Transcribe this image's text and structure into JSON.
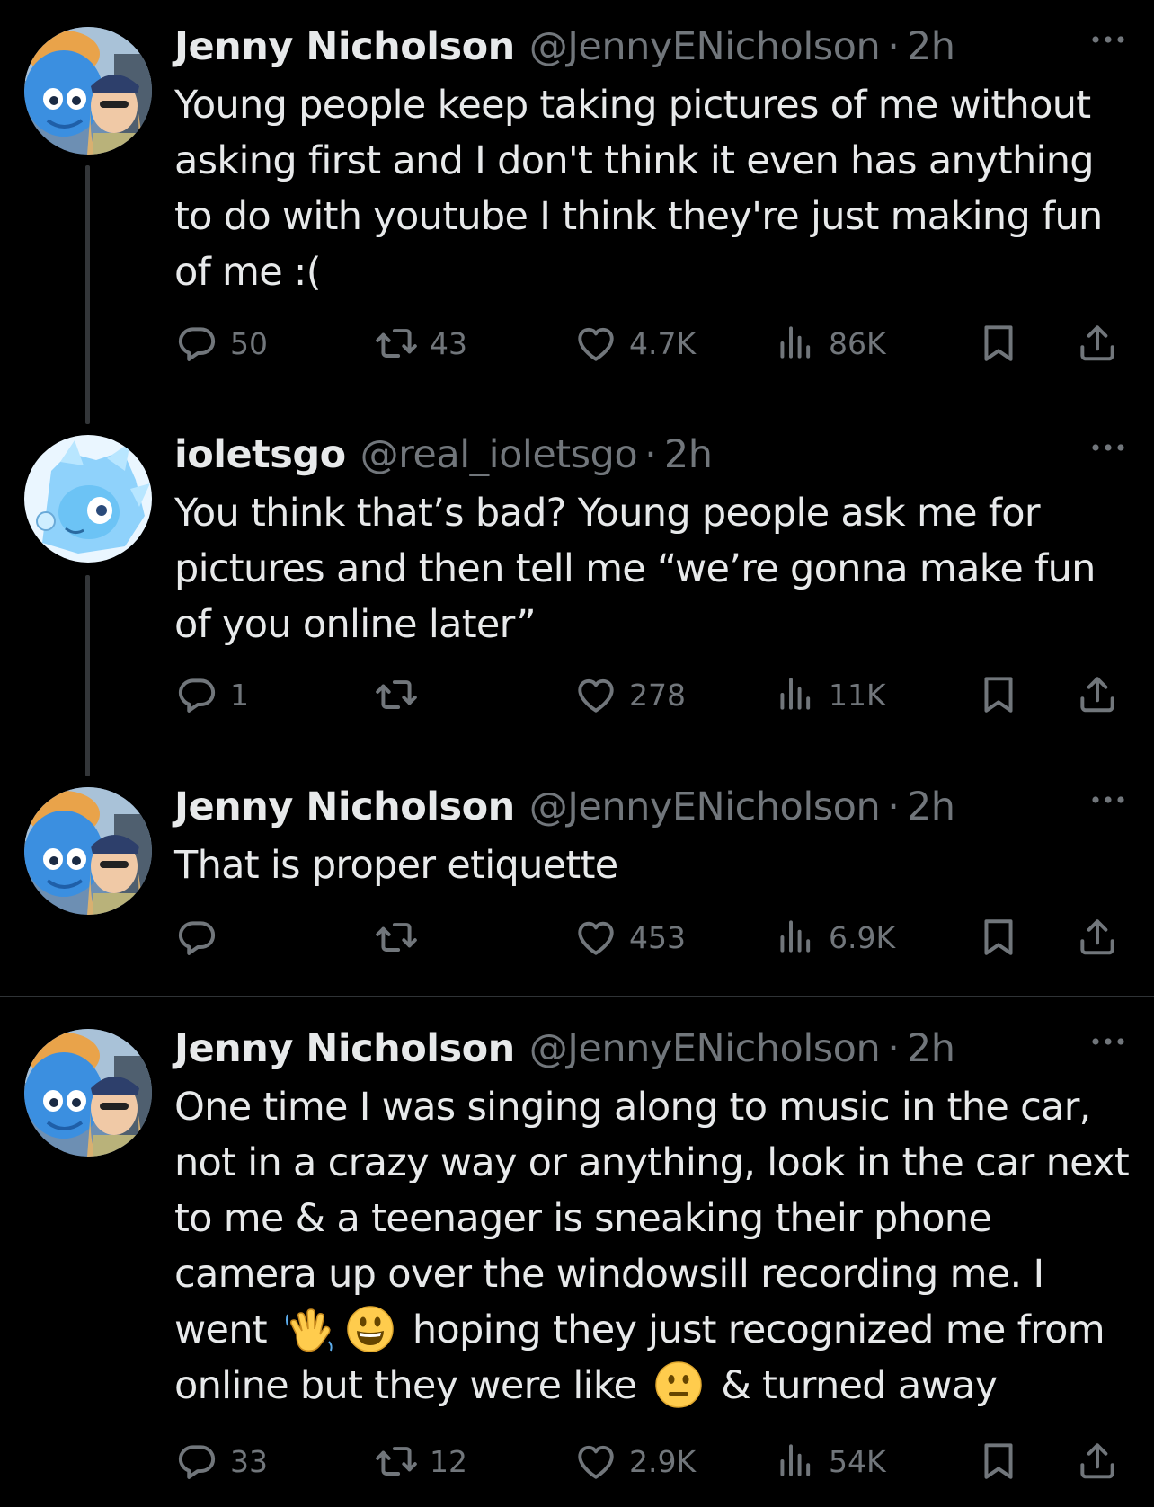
{
  "colors": {
    "background": "#000000",
    "text_primary": "#e7e9ea",
    "text_secondary": "#71767b",
    "thread_line": "#333639",
    "separator": "#2f3336"
  },
  "icons": {
    "reply": "reply-icon",
    "retweet": "retweet-icon",
    "like": "heart-icon",
    "views": "views-chart-icon",
    "bookmark": "bookmark-icon",
    "share": "share-icon",
    "more": "more-dots-icon"
  },
  "tweets": [
    {
      "name": "Jenny Nicholson",
      "handle": "@JennyENicholson",
      "time": "2h",
      "text": "Young people keep taking pictures of me without\nasking first and I don't think it even has anything\nto do with youtube I think they're just making fun\nof me :(",
      "replies": "50",
      "retweets": "43",
      "likes": "4.7K",
      "views": "86K"
    },
    {
      "name": "ioletsgo",
      "handle": "@real_ioletsgo",
      "time": "2h",
      "text": "You think that’s bad? Young people ask me for\npictures and then tell me “we’re gonna make fun\nof you online later”",
      "replies": "1",
      "retweets": "",
      "likes": "278",
      "views": "11K"
    },
    {
      "name": "Jenny Nicholson",
      "handle": "@JennyENicholson",
      "time": "2h",
      "text": "That is proper etiquette",
      "replies": "",
      "retweets": "",
      "likes": "453",
      "views": "6.9K"
    },
    {
      "name": "Jenny Nicholson",
      "handle": "@JennyENicholson",
      "time": "2h",
      "text_lines": [
        "One time I was singing along to music in the car,",
        "not in a crazy way or anything, look in the car next",
        "to me & a teenager is sneaking their phone",
        "camera up over the windowsill recording me. I"
      ],
      "text_went": "went",
      "text_hoping": "hoping they just recognized me from",
      "text_online": "online but they were like",
      "text_turned": "& turned away",
      "emoji_wave": "waving-hand-emoji",
      "emoji_smile": "grinning-face-emoji",
      "emoji_neutral": "neutral-face-emoji",
      "replies": "33",
      "retweets": "12",
      "likes": "2.9K",
      "views": "54K"
    }
  ]
}
